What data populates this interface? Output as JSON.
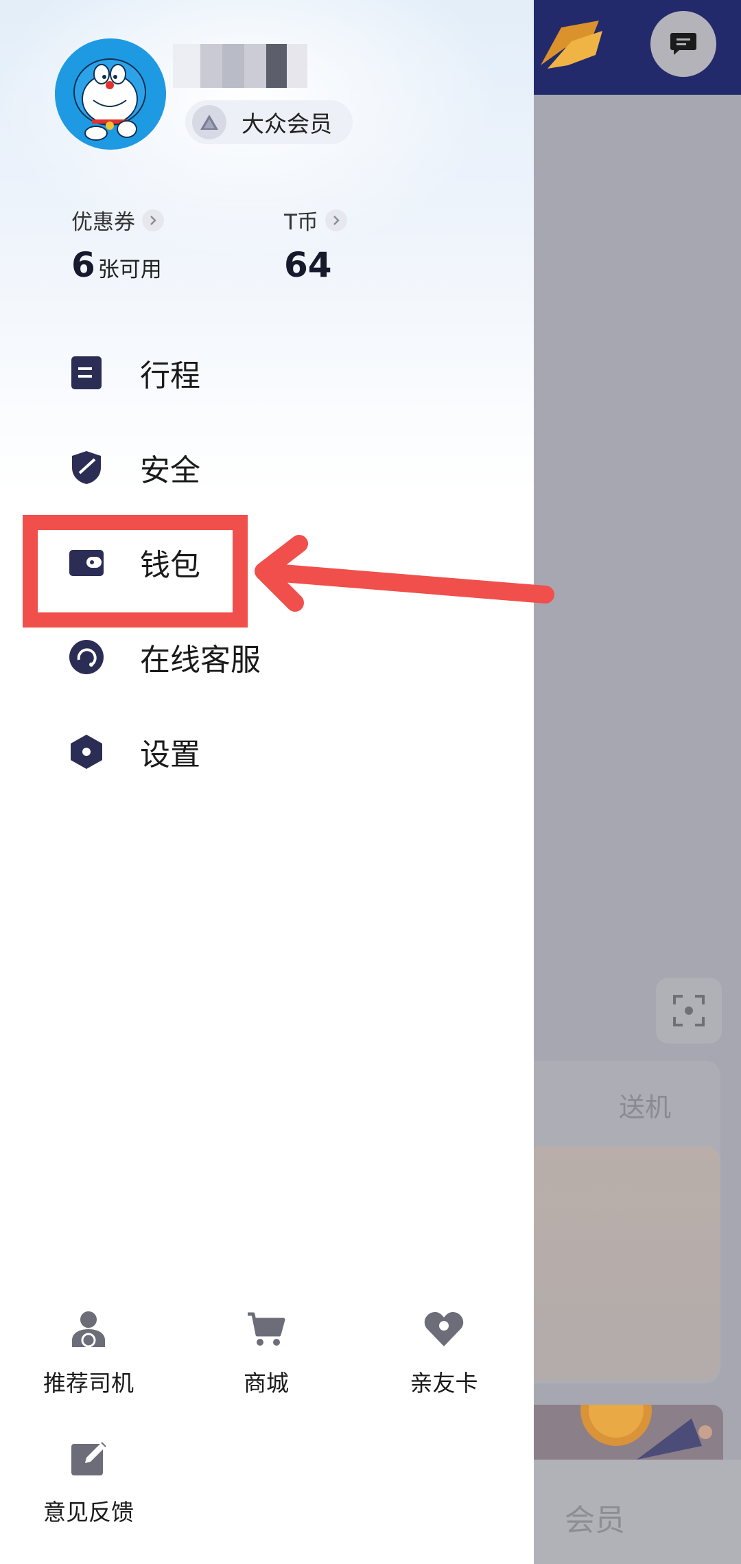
{
  "profile": {
    "member_level": "大众会员"
  },
  "stats": {
    "coupons": {
      "label": "优惠券",
      "value": "6",
      "unit": "张可用"
    },
    "tcoin": {
      "label": "T币",
      "value": "64"
    }
  },
  "menu": [
    {
      "label": "行程",
      "icon": "itinerary-icon"
    },
    {
      "label": "安全",
      "icon": "shield-icon"
    },
    {
      "label": "钱包",
      "icon": "wallet-icon"
    },
    {
      "label": "在线客服",
      "icon": "headset-icon"
    },
    {
      "label": "设置",
      "icon": "gear-icon"
    }
  ],
  "bottom_grid": [
    {
      "label": "推荐司机",
      "icon": "driver-icon"
    },
    {
      "label": "商城",
      "icon": "cart-icon"
    },
    {
      "label": "亲友卡",
      "icon": "heart-icon"
    },
    {
      "label": "意见反馈",
      "icon": "edit-icon"
    }
  ],
  "background_app": {
    "card_label": "送机",
    "bottom_tab_label": "会员"
  },
  "colors": {
    "highlight": "#f04f4b",
    "icon_dark": "#2c2d55",
    "overlay": "#a7a7b1"
  }
}
